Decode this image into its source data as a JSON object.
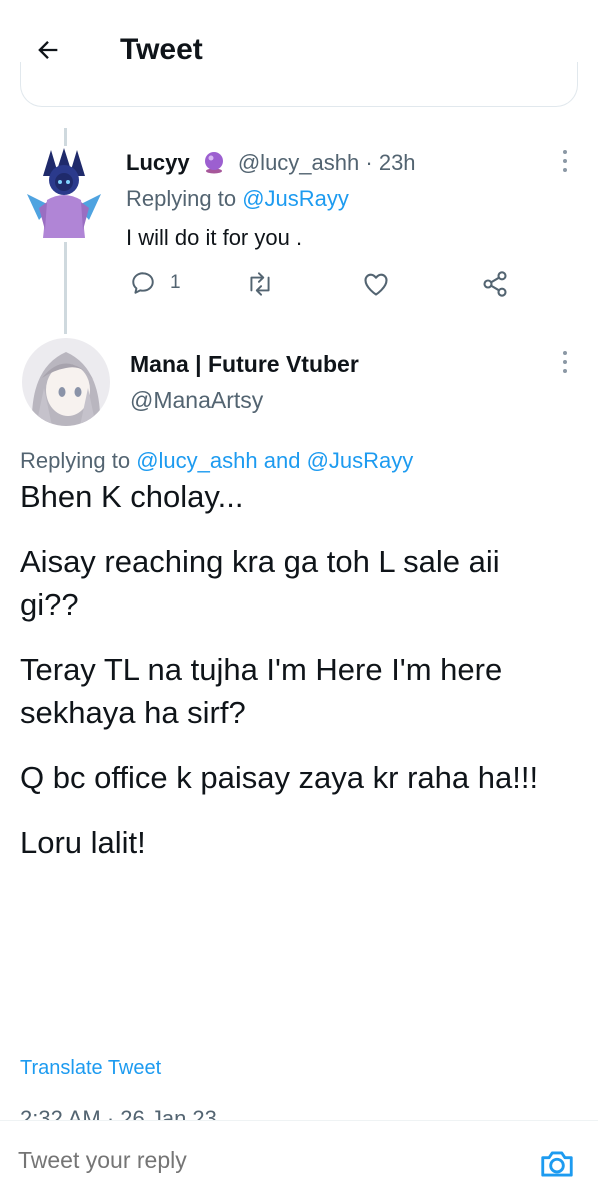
{
  "header": {
    "title": "Tweet"
  },
  "reply_tweet": {
    "display_name": "Lucyy",
    "handle": "@lucy_ashh",
    "separator": "·",
    "time": "23h",
    "replying_prefix": "Replying to",
    "replying_to": "@JusRayy",
    "text": "I will do it for you .",
    "reply_count": "1"
  },
  "main_tweet": {
    "display_name": "Mana | Future Vtuber",
    "handle": "@ManaArtsy",
    "replying_prefix": "Replying to",
    "replying_to_1": "@lucy_ashh",
    "replying_and": "and",
    "replying_to_2": "@JusRayy",
    "paragraphs": [
      "Bhen K cholay...",
      "Aisay reaching kra ga toh L sale aii gi??",
      "Teray TL na tujha I'm Here I'm here sekhaya ha sirf?",
      "Q bc office k paisay zaya kr raha ha!!!",
      "Loru lalit!"
    ],
    "translate_label": "Translate Tweet",
    "timestamp_partial": "2:32 AM · 26 Jan 23"
  },
  "reply_bar": {
    "placeholder": "Tweet your reply"
  },
  "colors": {
    "accent": "#1d9bf0",
    "muted": "#536471",
    "text": "#0f1419"
  },
  "icons": [
    "back-arrow-icon",
    "crystal-ball-icon",
    "more-vertical-icon",
    "reply-icon",
    "retweet-icon",
    "like-icon",
    "share-icon",
    "camera-icon"
  ]
}
